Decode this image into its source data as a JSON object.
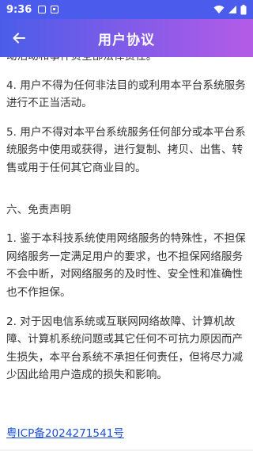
{
  "status_bar": {
    "time": "9:36",
    "background": "#4b5cec"
  },
  "app_bar": {
    "title": "用户协议",
    "back_icon": "arrow-left-icon"
  },
  "content": {
    "partial_top": "动活动和事件负全部法律责任。",
    "item4": "4. 用户不得为任何非法目的或利用本平台系统服务进行不正当活动。",
    "item5": "5. 用户不得对本平台系统服务任何部分或本平台系统服务中使用或获得，进行复制、拷贝、出售、转售或用于任何其它商业目的。",
    "section6_heading": "六、免责声明",
    "s6_item1": "1. 鉴于本科技系统使用网络服务的特殊性，不担保网络服务一定满足用户的要求，也不担保网络服务不会中断，对网络服务的及时性、安全性和准确性也不作担保。",
    "s6_item2": "2. 对于因电信系统或互联网网络故障、计算机故障、计算机系统问题或其它任何不可抗力原因而产生损失，本平台系统不承担任何责任，但将尽力减少因此给用户造成的损失和影响。",
    "icp_link": "粤ICP备2024271541号"
  },
  "colors": {
    "gradient_start": "#4a5de9",
    "gradient_end": "#b45ce6",
    "link": "#1a4fd6",
    "text": "#333333"
  }
}
